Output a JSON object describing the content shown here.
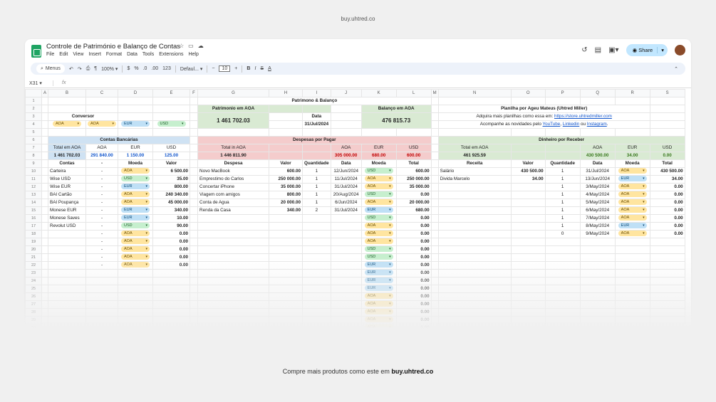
{
  "page": {
    "top_url": "buy.uhtred.co",
    "bottom_text": "Compre mais produtos como este em",
    "bottom_brand": "buy.uhtred.co"
  },
  "doc": {
    "title": "Controle de Património e Balanço de Contas",
    "menu": [
      "File",
      "Edit",
      "View",
      "Insert",
      "Format",
      "Data",
      "Tools",
      "Extensions",
      "Help"
    ]
  },
  "header": {
    "share": "Share"
  },
  "toolbar": {
    "search": "Menus",
    "zoom": "100%",
    "currency": "$",
    "percent": "%",
    "dec_less": ".0",
    "dec_more": ".00",
    "num": "123",
    "font": "Defaul...",
    "font_size": "10"
  },
  "formula": {
    "name_box": "X31",
    "fx": "fx"
  },
  "columns": [
    "",
    "A",
    "B",
    "C",
    "D",
    "E",
    "F",
    "G",
    "H",
    "I",
    "J",
    "K",
    "L",
    "M",
    "N",
    "O",
    "P",
    "Q",
    "R",
    "S"
  ],
  "titles": {
    "main": "Patrimono & Balanço",
    "planilha": "Planilha por Ageu Mateus (Uhtred Miller)",
    "adquira": "Adquira mais planilhas como essa em:",
    "store": "https://store.uhtredmiller.com",
    "acompanhe": "Acompanhe as novidades pelo",
    "yt": "YouTube",
    "sep1": ",",
    "li": "Linkedin",
    "ou": "ou",
    "ig": "Instagram",
    "dot": "."
  },
  "conversor": {
    "label": "Conversor",
    "c1": "AOA",
    "c2": "AOA",
    "c3": "EUR",
    "c4": "USD"
  },
  "summary": {
    "novo_lbl": "Patrimonio em AOA",
    "novo_val": "1 461 702.03",
    "data_lbl": "Data",
    "data_val": "31/Jul/2024",
    "bal_lbl": "Balanço em AOA",
    "bal_val": "476 815.73"
  },
  "contas": {
    "title": "Contas Bancárias",
    "h_total": "Total em AOA",
    "h_aoa": "AOA",
    "h_eur": "EUR",
    "h_usd": "USD",
    "total": "1 461 702.03",
    "aoa": "291 840.00",
    "eur": "1 150.00",
    "usd": "125.00",
    "cols": [
      "Contas",
      "-",
      "Moeda",
      "Valor"
    ],
    "rows": [
      [
        "Carteira",
        "-",
        "AOA",
        "6 500.00"
      ],
      [
        "Wise USD",
        "-",
        "USD",
        "35.00"
      ],
      [
        "Wise EUR",
        "-",
        "EUR",
        "800.00"
      ],
      [
        "BAI Cartão",
        "-",
        "AOA",
        "240 340.00"
      ],
      [
        "BAI Poupança",
        "-",
        "AOA",
        "45 000.00"
      ],
      [
        "Monese EUR",
        "-",
        "EUR",
        "340.00"
      ],
      [
        "Monese Saves",
        "-",
        "EUR",
        "10.00"
      ],
      [
        "Revolut USD",
        "-",
        "USD",
        "90.00"
      ],
      [
        "",
        "-",
        "AOA",
        "0.00"
      ],
      [
        "",
        "-",
        "AOA",
        "0.00"
      ],
      [
        "",
        "-",
        "AOA",
        "0.00"
      ],
      [
        "",
        "-",
        "AOA",
        "0.00"
      ],
      [
        "",
        "-",
        "AOA",
        "0.00"
      ]
    ]
  },
  "despesas": {
    "title": "Despesas por Pagar",
    "h_total": "Total in AOA",
    "h_aoa": "AOA",
    "h_eur": "EUR",
    "h_usd": "USD",
    "total": "1 446 811.90",
    "aoa": "305 000.00",
    "eur": "680.00",
    "usd": "600.00",
    "cols": [
      "Despesa",
      "Valor",
      "Quantidade",
      "Data",
      "Moeda",
      "Total"
    ],
    "rows": [
      [
        "Novo MacBook",
        "600.00",
        "1",
        "12/Jun/2024",
        "USD",
        "600.00"
      ],
      [
        "Emprestimo do Carlos",
        "250 000.00",
        "1",
        "11/Jul/2024",
        "AOA",
        "250 000.00"
      ],
      [
        "Concertar iPhone",
        "35 000.00",
        "1",
        "31/Jul/2024",
        "AOA",
        "35 000.00"
      ],
      [
        "Viagem com amigos",
        "800.00",
        "1",
        "20/Aug/2024",
        "USD",
        "0.00"
      ],
      [
        "Conta de Agua",
        "20 000.00",
        "1",
        "6/Jun/2024",
        "AOA",
        "20 000.00"
      ],
      [
        "Renda da Casa",
        "340.00",
        "2",
        "31/Jul/2024",
        "EUR",
        "680.00"
      ],
      [
        "",
        "",
        "",
        "",
        "USD",
        "0.00"
      ],
      [
        "",
        "",
        "",
        "",
        "AOA",
        "0.00"
      ],
      [
        "",
        "",
        "",
        "",
        "AOA",
        "0.00"
      ],
      [
        "",
        "",
        "",
        "",
        "AOA",
        "0.00"
      ],
      [
        "",
        "",
        "",
        "",
        "USD",
        "0.00"
      ],
      [
        "",
        "",
        "",
        "",
        "USD",
        "0.00"
      ],
      [
        "",
        "",
        "",
        "",
        "EUR",
        "0.00"
      ],
      [
        "",
        "",
        "",
        "",
        "EUR",
        "0.00"
      ],
      [
        "",
        "",
        "",
        "",
        "EUR",
        "0.00"
      ],
      [
        "",
        "",
        "",
        "",
        "EUR",
        "0.00"
      ],
      [
        "",
        "",
        "",
        "",
        "AOA",
        "0.00"
      ],
      [
        "",
        "",
        "",
        "",
        "AOA",
        "0.00"
      ],
      [
        "",
        "",
        "",
        "",
        "AOA",
        "0.00"
      ],
      [
        "",
        "",
        "",
        "",
        "AOA",
        "0.00"
      ],
      [
        "",
        "",
        "",
        "",
        "AOA",
        "0.00"
      ],
      [
        "",
        "",
        "",
        "",
        "AOA",
        "0.00"
      ],
      [
        "",
        "",
        "",
        "",
        "AOA",
        "0.00"
      ]
    ]
  },
  "receber": {
    "title": "Dinheiro por Receber",
    "h_total": "Total em AOA",
    "h_aoa": "AOA",
    "h_eur": "EUR",
    "h_usd": "USD",
    "total": "461 925.59",
    "aoa": "430 500.00",
    "eur": "34.00",
    "usd": "0.00",
    "cols": [
      "Receita",
      "Valor",
      "Quantidade",
      "Data",
      "Moeda",
      "Total"
    ],
    "rows": [
      [
        "Salário",
        "430 500.00",
        "1",
        "31/Jul/2024",
        "AOA",
        "430 500.00"
      ],
      [
        "Divida Marcelo",
        "34.00",
        "1",
        "13/Jun/2024",
        "EUR",
        "34.00"
      ],
      [
        "",
        "",
        "1",
        "3/May/2024",
        "AOA",
        "0.00"
      ],
      [
        "",
        "",
        "1",
        "4/May/2024",
        "AOA",
        "0.00"
      ],
      [
        "",
        "",
        "1",
        "5/May/2024",
        "AOA",
        "0.00"
      ],
      [
        "",
        "",
        "1",
        "6/May/2024",
        "AOA",
        "0.00"
      ],
      [
        "",
        "",
        "1",
        "7/May/2024",
        "AOA",
        "0.00"
      ],
      [
        "",
        "",
        "1",
        "8/May/2024",
        "EUR",
        "0.00"
      ],
      [
        "",
        "",
        "0",
        "9/May/2024",
        "AOA",
        "0.00"
      ]
    ]
  }
}
